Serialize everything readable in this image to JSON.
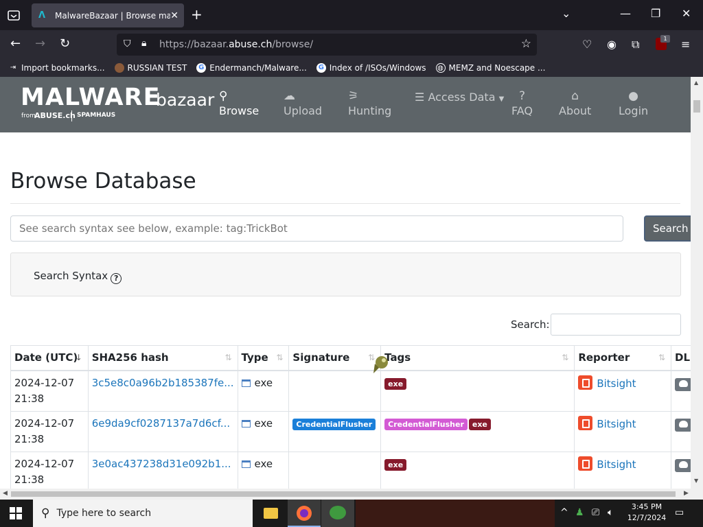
{
  "browser": {
    "tab_title": "MalwareBazaar | Browse malware",
    "tab_favicon": "Λ",
    "url_prefix": "https://bazaar.",
    "url_domain": "abuse.ch",
    "url_path": "/browse/",
    "extension_badge": "1",
    "bookmarks": [
      {
        "label": "Import bookmarks...",
        "icon": "import-icon"
      },
      {
        "label": "RUSSIAN TEST",
        "icon": "github-icon"
      },
      {
        "label": "Endermanch/Malware...",
        "icon": "google-icon"
      },
      {
        "label": "Index of /ISOs/Windows",
        "icon": "google-icon"
      },
      {
        "label": "MEMZ and Noescape ...",
        "icon": "globe-icon"
      }
    ]
  },
  "site": {
    "logo_main": "MALWARE",
    "logo_sub": "bazaar",
    "logo_from": "from",
    "logo_abuse": "ABUSE.ch",
    "logo_spamhaus": "SPAMHAUS",
    "menu": {
      "browse": "Browse",
      "upload": "Upload",
      "hunting": "Hunting",
      "access": "Access Data",
      "faq": "FAQ",
      "about": "About",
      "login": "Login"
    }
  },
  "page": {
    "title": "Browse Database",
    "search_placeholder": "See search syntax see below, example: tag:TrickBot",
    "search_button": "Search",
    "syntax_label": "Search Syntax",
    "table_search_label": "Search:"
  },
  "table": {
    "headers": {
      "date": "Date (UTC)",
      "hash": "SHA256 hash",
      "type": "Type",
      "signature": "Signature",
      "tags": "Tags",
      "reporter": "Reporter",
      "dl": "DL"
    },
    "rows": [
      {
        "date": "2024-12-07",
        "time": "21:38",
        "hash": "3c5e8c0a96b2b185387fe...",
        "type": "exe",
        "signature": "",
        "tags": [
          "exe"
        ],
        "reporter": "Bitsight"
      },
      {
        "date": "2024-12-07",
        "time": "21:38",
        "hash": "6e9da9cf0287137a7d6cf...",
        "type": "exe",
        "signature": "CredentialFlusher",
        "tags": [
          "CredentialFlusher",
          "exe"
        ],
        "reporter": "Bitsight"
      },
      {
        "date": "2024-12-07",
        "time": "21:38",
        "hash": "3e0ac437238d31e092b1...",
        "type": "exe",
        "signature": "",
        "tags": [
          "exe"
        ],
        "reporter": "Bitsight"
      }
    ]
  },
  "colors": {
    "tag_exe": "#861a2c",
    "tag_credential": "#d35bd4",
    "signature_badge": "#1a7fd9",
    "header_bg": "#5d6468",
    "link": "#1b75bb"
  },
  "taskbar": {
    "search_placeholder": "Type here to search",
    "time": "3:45 PM",
    "date": "12/7/2024"
  }
}
